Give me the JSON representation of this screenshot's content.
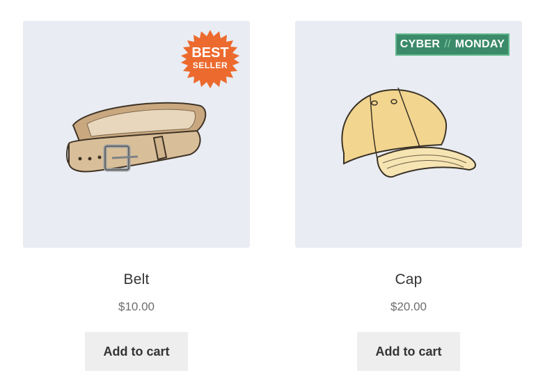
{
  "products": [
    {
      "title": "Belt",
      "price": "$10.00",
      "button_label": "Add to cart",
      "badge": {
        "line1": "BEST",
        "line2": "SELLER",
        "color": "#ec6a2e"
      },
      "icon": "belt-image"
    },
    {
      "title": "Cap",
      "price": "$20.00",
      "button_label": "Add to cart",
      "badge": {
        "word1": "CYBER",
        "separator": "//",
        "word2": "MONDAY",
        "color": "#3b8a6a"
      },
      "icon": "cap-image"
    }
  ],
  "colors": {
    "thumb_bg": "#e9ecf2",
    "button_bg": "#eeeeee",
    "title": "#333333",
    "price": "#6d6d6d"
  }
}
